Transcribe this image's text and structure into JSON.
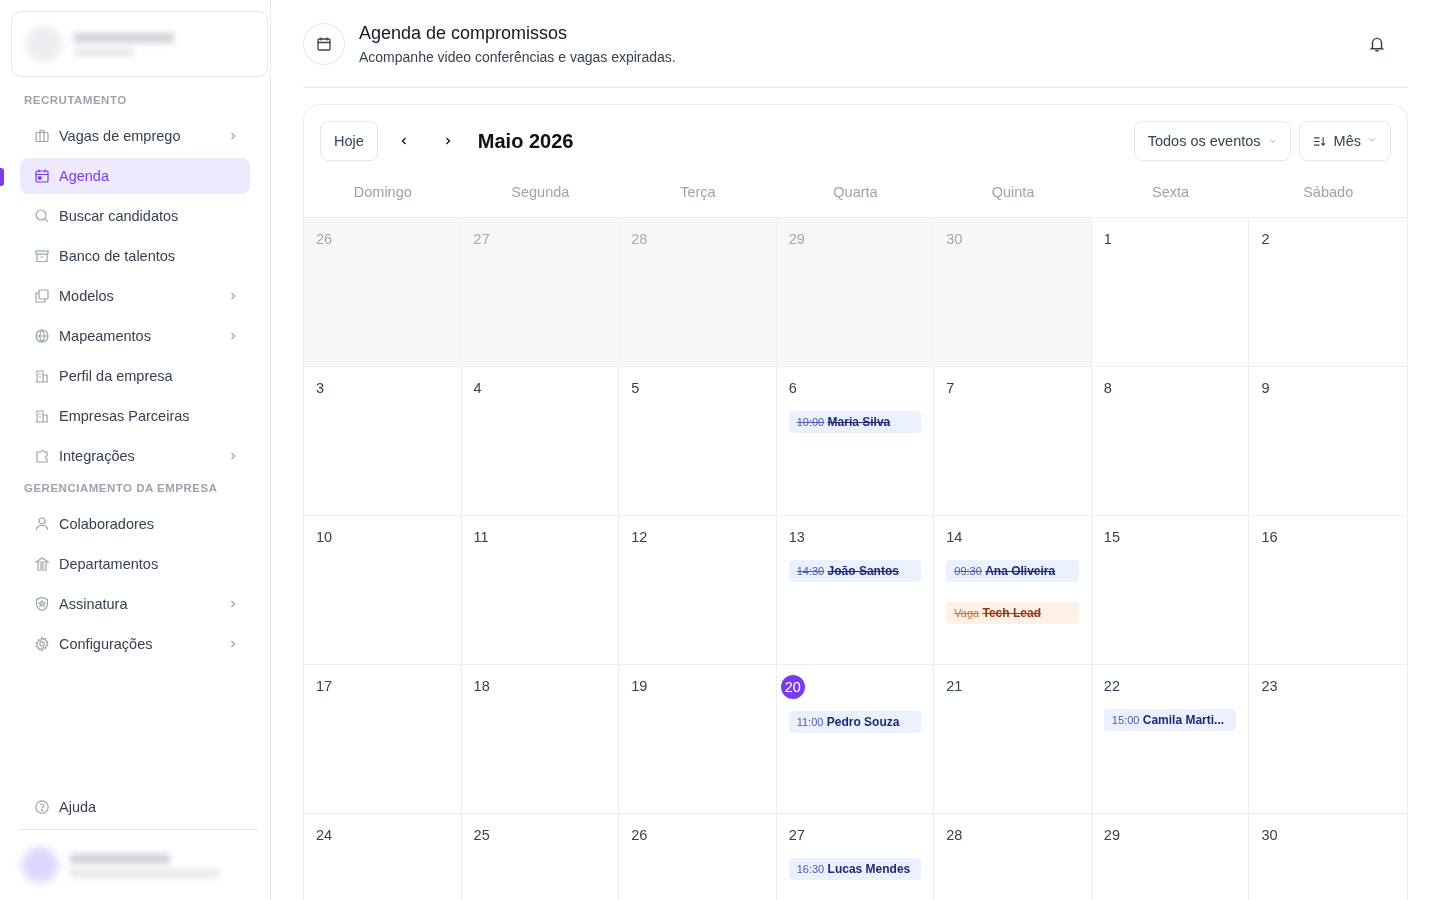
{
  "sidebar": {
    "sections": [
      {
        "title": "RECRUTAMENTO",
        "items": [
          {
            "label": "Vagas de emprego",
            "selected": false,
            "has_submenu": true
          },
          {
            "label": "Agenda",
            "selected": true,
            "has_submenu": false
          },
          {
            "label": "Buscar candidatos",
            "selected": false,
            "has_submenu": false
          },
          {
            "label": "Banco de talentos",
            "selected": false,
            "has_submenu": false
          },
          {
            "label": "Modelos",
            "selected": false,
            "has_submenu": true
          },
          {
            "label": "Mapeamentos",
            "selected": false,
            "has_submenu": true
          },
          {
            "label": "Perfil da empresa",
            "selected": false,
            "has_submenu": false
          },
          {
            "label": "Empresas Parceiras",
            "selected": false,
            "has_submenu": false
          },
          {
            "label": "Integrações",
            "selected": false,
            "has_submenu": true
          }
        ]
      },
      {
        "title": "GERENCIAMENTO DA EMPRESA",
        "items": [
          {
            "label": "Colaboradores",
            "selected": false,
            "has_submenu": false
          },
          {
            "label": "Departamentos",
            "selected": false,
            "has_submenu": false
          },
          {
            "label": "Assinatura",
            "selected": false,
            "has_submenu": true
          },
          {
            "label": "Configurações",
            "selected": false,
            "has_submenu": true
          }
        ]
      }
    ],
    "help": {
      "label": "Ajuda"
    }
  },
  "header": {
    "title": "Agenda de compromissos",
    "subtitle": "Acompanhe video conferências e vagas expiradas."
  },
  "calendar": {
    "today_button": "Hoje",
    "month": "Maio 2026",
    "filter": "Todos os eventos",
    "view": "Mês",
    "weekdays": [
      "Domingo",
      "Segunda",
      "Terça",
      "Quarta",
      "Quinta",
      "Sexta",
      "Sábado"
    ],
    "weeks": [
      [
        {
          "day": "26",
          "outside": true,
          "today": false
        },
        {
          "day": "27",
          "outside": true,
          "today": false
        },
        {
          "day": "28",
          "outside": true,
          "today": false
        },
        {
          "day": "29",
          "outside": true,
          "today": false
        },
        {
          "day": "30",
          "outside": true,
          "today": false
        },
        {
          "day": "1",
          "outside": false,
          "today": false
        },
        {
          "day": "2",
          "outside": false,
          "today": false
        }
      ],
      [
        {
          "day": "3",
          "outside": false,
          "today": false
        },
        {
          "day": "4",
          "outside": false,
          "today": false
        },
        {
          "day": "5",
          "outside": false,
          "today": false
        },
        {
          "day": "6",
          "outside": false,
          "today": false,
          "events": [
            {
              "kind": "interview",
              "prefix": "10:00",
              "title": "Maria Silva",
              "expired": true
            }
          ]
        },
        {
          "day": "7",
          "outside": false,
          "today": false
        },
        {
          "day": "8",
          "outside": false,
          "today": false
        },
        {
          "day": "9",
          "outside": false,
          "today": false
        }
      ],
      [
        {
          "day": "10",
          "outside": false,
          "today": false
        },
        {
          "day": "11",
          "outside": false,
          "today": false
        },
        {
          "day": "12",
          "outside": false,
          "today": false
        },
        {
          "day": "13",
          "outside": false,
          "today": false,
          "events": [
            {
              "kind": "interview",
              "prefix": "14:30",
              "title": "João Santos",
              "expired": true
            }
          ]
        },
        {
          "day": "14",
          "outside": false,
          "today": false,
          "events": [
            {
              "kind": "interview",
              "prefix": "09:30",
              "title": "Ana Oliveira",
              "expired": true
            },
            {
              "kind": "vacancy",
              "prefix": "Vaga",
              "title": "Tech Lead",
              "expired": true
            }
          ]
        },
        {
          "day": "15",
          "outside": false,
          "today": false
        },
        {
          "day": "16",
          "outside": false,
          "today": false
        }
      ],
      [
        {
          "day": "17",
          "outside": false,
          "today": false
        },
        {
          "day": "18",
          "outside": false,
          "today": false
        },
        {
          "day": "19",
          "outside": false,
          "today": false
        },
        {
          "day": "20",
          "outside": false,
          "today": true,
          "events": [
            {
              "kind": "interview",
              "prefix": "11:00",
              "title": "Pedro Souza",
              "expired": false
            }
          ]
        },
        {
          "day": "21",
          "outside": false,
          "today": false
        },
        {
          "day": "22",
          "outside": false,
          "today": false,
          "events": [
            {
              "kind": "interview",
              "prefix": "15:00",
              "title": "Camila Marti...",
              "expired": false
            }
          ]
        },
        {
          "day": "23",
          "outside": false,
          "today": false
        }
      ],
      [
        {
          "day": "24",
          "outside": false,
          "today": false
        },
        {
          "day": "25",
          "outside": false,
          "today": false
        },
        {
          "day": "26",
          "outside": false,
          "today": false
        },
        {
          "day": "27",
          "outside": false,
          "today": false,
          "events": [
            {
              "kind": "interview",
              "prefix": "16:30",
              "title": "Lucas Mendes",
              "expired": false
            }
          ]
        },
        {
          "day": "28",
          "outside": false,
          "today": false
        },
        {
          "day": "29",
          "outside": false,
          "today": false
        },
        {
          "day": "30",
          "outside": false,
          "today": false
        }
      ]
    ]
  }
}
